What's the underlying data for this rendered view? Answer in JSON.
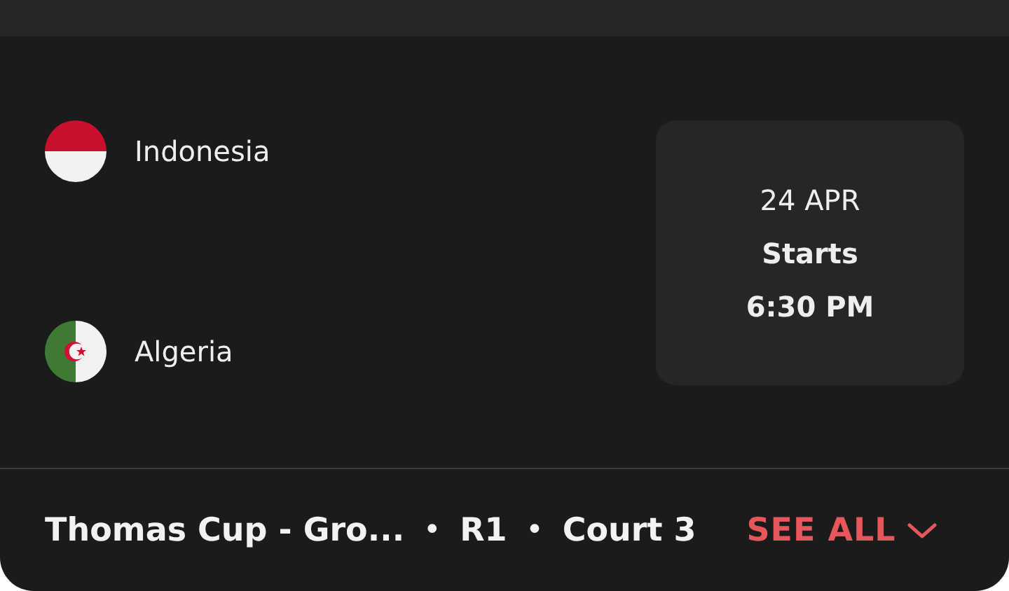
{
  "teams": [
    {
      "name": "Indonesia",
      "kind": "indonesia"
    },
    {
      "name": "Algeria",
      "kind": "algeria"
    }
  ],
  "schedule": {
    "date": "24 APR",
    "label": "Starts",
    "time": "6:30 PM"
  },
  "footer": {
    "event": "Thomas Cup - Gro...",
    "separator_1": "•",
    "round": "R1",
    "separator_2": "•",
    "court": "Court 3",
    "link": "SEE ALL"
  }
}
